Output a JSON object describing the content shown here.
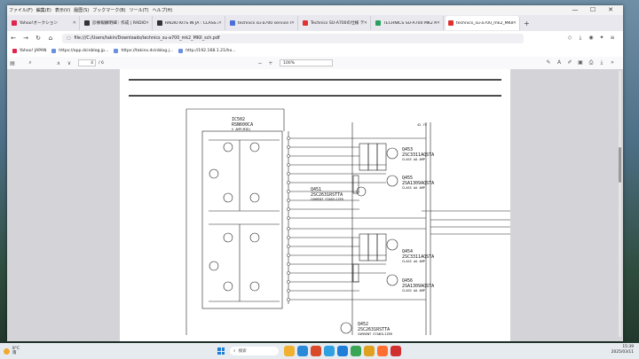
{
  "menu": [
    "ファイル(F)",
    "編集(E)",
    "表示(V)",
    "履歴(S)",
    "ブックマーク(B)",
    "ツール(T)",
    "ヘルプ(H)"
  ],
  "tabs": [
    {
      "label": "Yahoo!オークション",
      "color": "#e0244c",
      "active": false
    },
    {
      "label": "診療報酬明細｜作成 | RADIO KITS",
      "color": "#333333",
      "active": false
    },
    {
      "label": "RADIO KITS IN JA : CLASS AA",
      "color": "#333333",
      "active": false
    },
    {
      "label": "technics su-a700 service manua",
      "color": "#4a6fd8",
      "active": false
    },
    {
      "label": "Technics SU-A700の仕様 テクニ",
      "color": "#e03030",
      "active": false
    },
    {
      "label": "TECHNICS SU-A700 MK2 MKII",
      "color": "#2aa060",
      "active": false
    },
    {
      "label": "technics_su-a700_mk2_MKII_sch.pdf",
      "color": "#e03030",
      "active": true
    }
  ],
  "url": "file:///C:/Users/takin/Downloads/technics_su-a700_mk2_MKII_sch.pdf",
  "bookmarks": [
    {
      "label": "Yahoo! JAPAN",
      "color": "#e0244c"
    },
    {
      "label": "https://app.dcinblog.jp...",
      "color": "#6a8ee0"
    },
    {
      "label": "https://takinx.dcinblog.j...",
      "color": "#6a8ee0"
    },
    {
      "label": "http://192.168.1.21/ho...",
      "color": "#6a8ee0"
    }
  ],
  "pdf": {
    "page": "4",
    "total": "/ 6",
    "zoom": "100%"
  },
  "schematic": {
    "ic_label": "IC502",
    "ic_part": "RSN600CA",
    "ic_note": "V AMP(MID)",
    "voltage_top": "42.7V",
    "transistors": [
      {
        "ref": "Q453",
        "part": "2SC3311AQSTA",
        "note": "CLASS AA AMP"
      },
      {
        "ref": "Q455",
        "part": "2SA1309AQSTA",
        "note": "CLASS AA AMP"
      },
      {
        "ref": "Q451",
        "part": "2SC2631RSTTA",
        "note": "CURRENT STABILIZER"
      },
      {
        "ref": "Q454",
        "part": "2SC3311AQSTA",
        "note": "CLASS AA AMP"
      },
      {
        "ref": "Q456",
        "part": "2SA1309AQSTA",
        "note": "CLASS AA AMP"
      },
      {
        "ref": "Q452",
        "part": "2SC2631RSTTA",
        "note": "CURRENT STABILIZER"
      }
    ]
  },
  "taskbar": {
    "weather_temp": "8°C",
    "weather_text": "雨",
    "search": "検索",
    "time": "15:39",
    "date": "2025/03/11",
    "apps": [
      "#f0b030",
      "#2a8ad8",
      "#d84a2a",
      "#30a0e0",
      "#1f7fd8",
      "#3aa655",
      "#e0a020",
      "#ff7030",
      "#d03030"
    ]
  }
}
